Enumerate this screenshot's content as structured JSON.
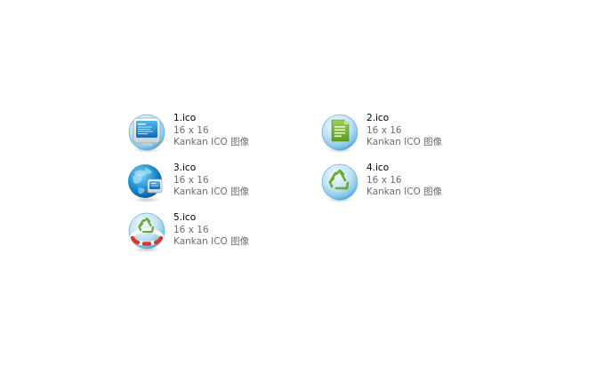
{
  "files": [
    {
      "name": "1.ico",
      "dimensions": "16 x 16",
      "type": "Kankan ICO 图像",
      "icon": "monitor-screen-icon"
    },
    {
      "name": "2.ico",
      "dimensions": "16 x 16",
      "type": "Kankan ICO 图像",
      "icon": "document-icon"
    },
    {
      "name": "3.ico",
      "dimensions": "16 x 16",
      "type": "Kankan ICO 图像",
      "icon": "globe-monitor-icon"
    },
    {
      "name": "4.ico",
      "dimensions": "16 x 16",
      "type": "Kankan ICO 图像",
      "icon": "recycle-icon"
    },
    {
      "name": "5.ico",
      "dimensions": "16 x 16",
      "type": "Kankan ICO 图像",
      "icon": "recycle-lifebuoy-icon"
    }
  ],
  "colors": {
    "filename_text": "#000000",
    "meta_text": "#6d6d6d",
    "icon_blue": "#3aa6dc",
    "icon_green": "#7ab73a",
    "lifebuoy_red": "#d23a2a"
  }
}
